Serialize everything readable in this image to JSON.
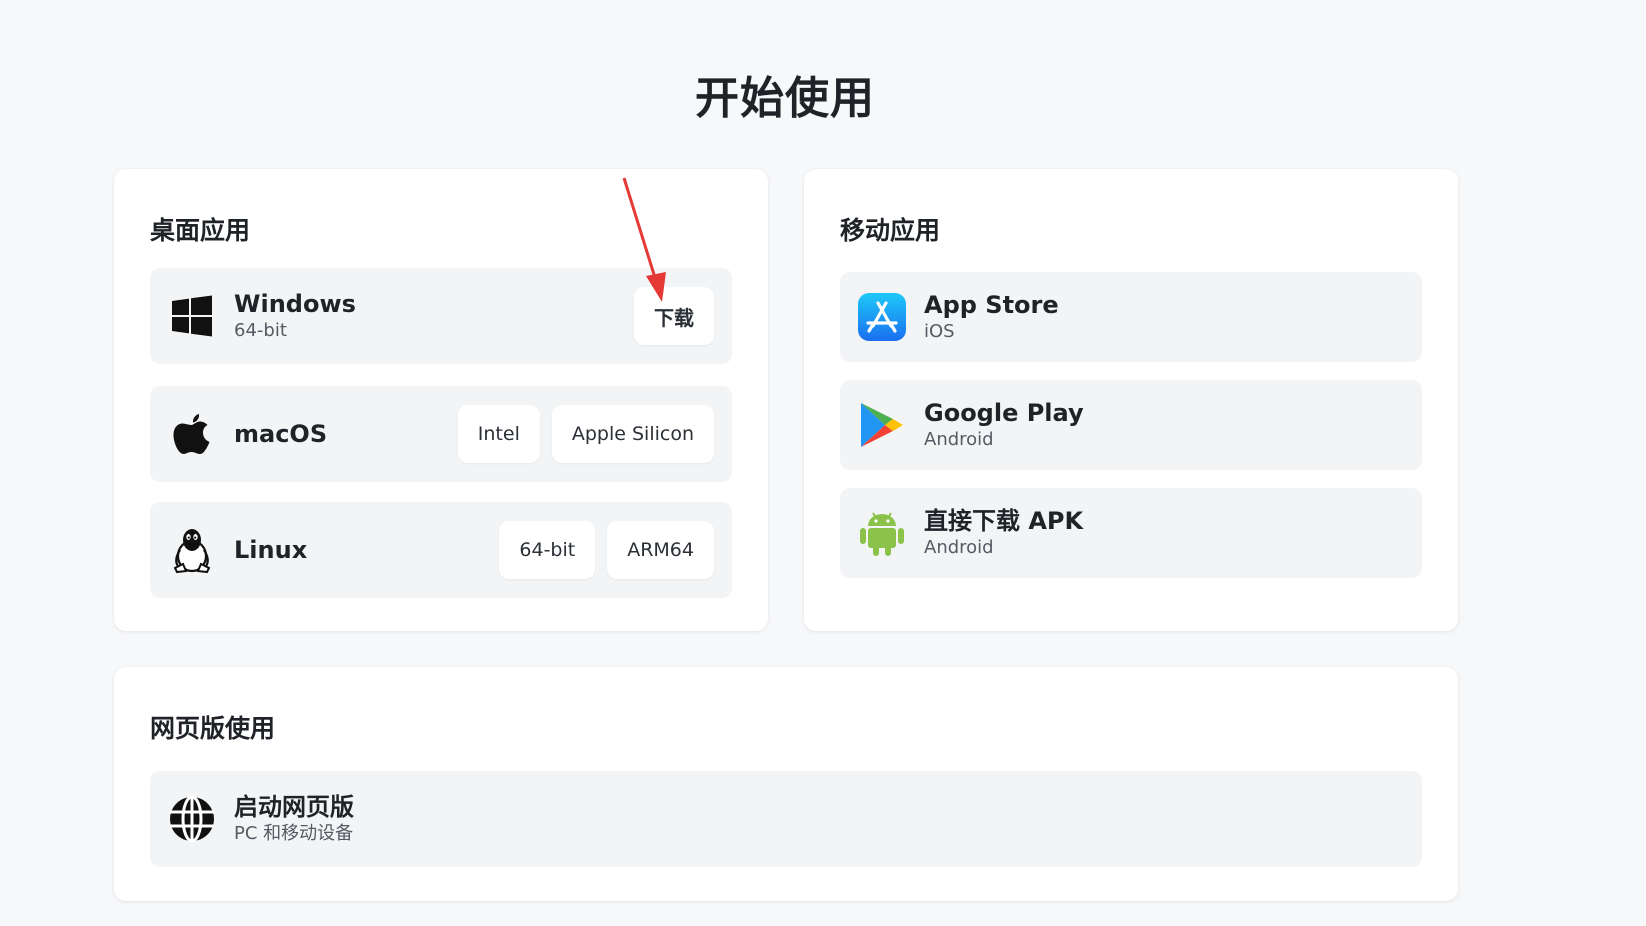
{
  "page": {
    "title": "开始使用"
  },
  "desktop": {
    "title": "桌面应用",
    "windows": {
      "name": "Windows",
      "sub": "64-bit",
      "download_label": "下载"
    },
    "macos": {
      "name": "macOS",
      "intel_label": "Intel",
      "apple_silicon_label": "Apple Silicon"
    },
    "linux": {
      "name": "Linux",
      "x64_label": "64-bit",
      "arm64_label": "ARM64"
    }
  },
  "mobile": {
    "title": "移动应用",
    "appstore": {
      "name": "App Store",
      "sub": "iOS"
    },
    "googleplay": {
      "name": "Google Play",
      "sub": "Android"
    },
    "apk": {
      "name": "直接下载 APK",
      "sub": "Android"
    }
  },
  "web": {
    "title": "网页版使用",
    "launch": {
      "name": "启动网页版",
      "sub": "PC 和移动设备"
    }
  },
  "colors": {
    "background": "#f7f8fa",
    "card": "#ffffff",
    "row": "#f3f4f6",
    "arrow": "#e53935",
    "android_green": "#8bc34a",
    "appstore_blue": "#1a8cf0"
  },
  "icons": [
    "windows-icon",
    "apple-icon",
    "linux-icon",
    "app-store-icon",
    "google-play-icon",
    "android-icon",
    "globe-icon"
  ]
}
